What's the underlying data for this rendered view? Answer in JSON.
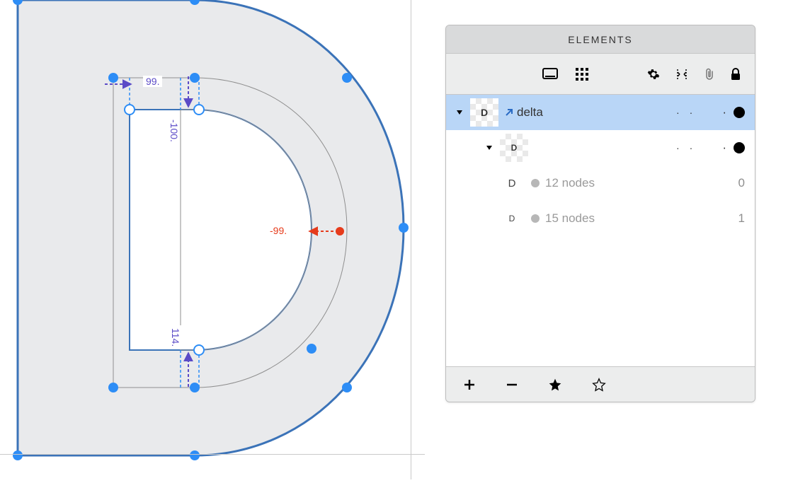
{
  "panel": {
    "title": "ELEMENTS",
    "rows": [
      {
        "id": "delta-parent",
        "label": "delta",
        "thumb_letter": "D",
        "thumb_size": 14,
        "link": true,
        "selected": true,
        "has_dots": true,
        "has_trailing_dot": true
      },
      {
        "id": "delta-child",
        "label": "",
        "thumb_letter": "D",
        "thumb_size": 12,
        "selected": false,
        "has_dots": true,
        "has_trailing_dot": true,
        "indent": 1
      },
      {
        "id": "path-12",
        "label": "12 nodes",
        "thumb_letter": "D",
        "thumb_size": 13,
        "trailing_num": "0",
        "indent": 2
      },
      {
        "id": "path-15",
        "label": "15 nodes",
        "thumb_letter": "D",
        "thumb_size": 10,
        "trailing_num": "1",
        "indent": 2
      }
    ],
    "footer": [
      "add",
      "remove",
      "star-filled",
      "star-outline"
    ]
  },
  "measures": {
    "m99": "99.",
    "mNeg100": "-100.",
    "mNeg99": "-99.",
    "m114": "114."
  },
  "colors": {
    "selection": "#b9d6f7",
    "node_blue": "#2d8df6",
    "accent_purple": "#5b4bc7",
    "accent_red": "#e63b1b"
  }
}
